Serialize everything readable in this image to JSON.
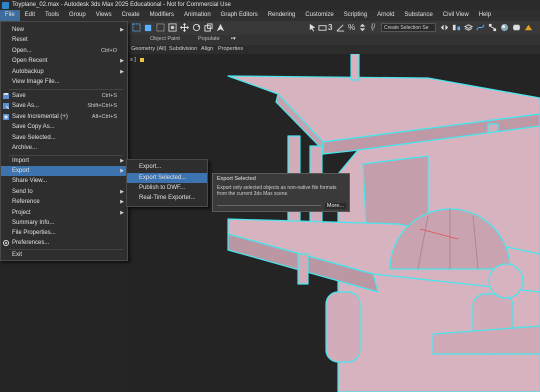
{
  "window": {
    "title": "Toyplane_02.max - Autodesk 3ds Max 2025 Educational - Not for Commercial Use"
  },
  "menubar": [
    "File",
    "Edit",
    "Tools",
    "Group",
    "Views",
    "Create",
    "Modifiers",
    "Animation",
    "Graph Editors",
    "Rendering",
    "Customize",
    "Scripting",
    "Arnold",
    "Substance",
    "Civil View",
    "Help"
  ],
  "toolbar": {
    "selection_set_placeholder": "Create Selection Se",
    "view_dropdown": "View"
  },
  "ribbon": {
    "object_paint": "Object Paint",
    "populate": "Populate",
    "tabs": [
      "Geometry (All)",
      "Subdivision",
      "Align",
      "Properties"
    ]
  },
  "viewport": {
    "label": "s ]"
  },
  "file_menu": {
    "items": [
      {
        "label": "New",
        "shortcut": "",
        "submenu": true
      },
      {
        "label": "Reset",
        "shortcut": "",
        "submenu": false
      },
      {
        "label": "Open...",
        "shortcut": "Ctrl+O",
        "submenu": false
      },
      {
        "label": "Open Recent",
        "shortcut": "",
        "submenu": true
      },
      {
        "label": "Autobackup",
        "shortcut": "",
        "submenu": true
      },
      {
        "label": "View Image File...",
        "shortcut": "",
        "submenu": false
      },
      {
        "label": "Save",
        "shortcut": "Ctrl+S",
        "submenu": false
      },
      {
        "label": "Save As...",
        "shortcut": "Shift+Ctrl+S",
        "submenu": false
      },
      {
        "label": "Save Incremental (+)",
        "shortcut": "Alt+Ctrl+S",
        "submenu": false
      },
      {
        "label": "Save Copy As...",
        "shortcut": "",
        "submenu": false
      },
      {
        "label": "Save Selected...",
        "shortcut": "",
        "submenu": false
      },
      {
        "label": "Archive...",
        "shortcut": "",
        "submenu": false
      },
      {
        "label": "Import",
        "shortcut": "",
        "submenu": true
      },
      {
        "label": "Export",
        "shortcut": "",
        "submenu": true
      },
      {
        "label": "Share View...",
        "shortcut": "",
        "submenu": false
      },
      {
        "label": "Send to",
        "shortcut": "",
        "submenu": true
      },
      {
        "label": "Reference",
        "shortcut": "",
        "submenu": true
      },
      {
        "label": "Project",
        "shortcut": "",
        "submenu": true
      },
      {
        "label": "Summary Info...",
        "shortcut": "",
        "submenu": false
      },
      {
        "label": "File Properties...",
        "shortcut": "",
        "submenu": false
      },
      {
        "label": "Preferences...",
        "shortcut": "",
        "submenu": false
      },
      {
        "label": "Exit",
        "shortcut": "",
        "submenu": false
      }
    ]
  },
  "export_submenu": {
    "items": [
      "Export...",
      "Export Selected...",
      "Publish to DWF...",
      "Real-Time Exporter..."
    ]
  },
  "tooltip": {
    "title": "Export Selected",
    "body": "Export only selected objects as non-native file formats from the current 3ds Max scene.",
    "more": "More..."
  },
  "colors": {
    "highlight": "#3d74b0",
    "model": "#d7b3bf",
    "outline": "#46e6ee"
  }
}
